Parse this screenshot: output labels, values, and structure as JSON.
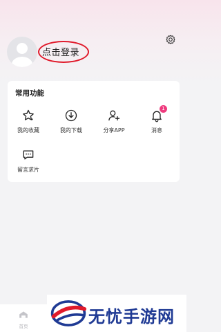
{
  "profile": {
    "login_label": "点击登录"
  },
  "card": {
    "title": "常用功能",
    "features": [
      {
        "label": "我的收藏",
        "icon": "star-icon"
      },
      {
        "label": "我的下载",
        "icon": "download-icon"
      },
      {
        "label": "分享APP",
        "icon": "share-user-icon"
      },
      {
        "label": "消息",
        "icon": "bell-icon",
        "badge": "1"
      },
      {
        "label": "留言求片",
        "icon": "chat-icon"
      }
    ]
  },
  "tabbar": {
    "home_label": "首页"
  },
  "watermark": {
    "text": "无忧手游网"
  },
  "colors": {
    "accent_pink": "#ef3b7e",
    "annotation_red": "#e01a2b",
    "watermark_blue": "#1f3a94"
  }
}
